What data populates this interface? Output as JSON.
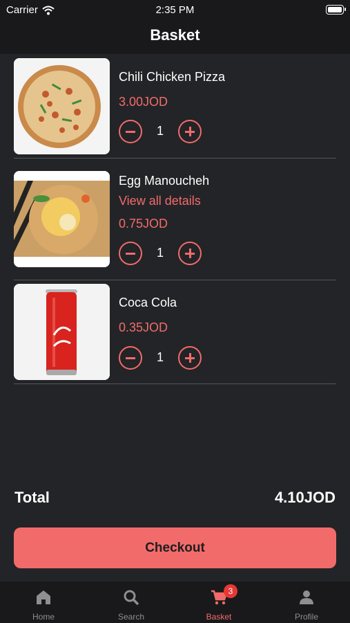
{
  "status": {
    "carrier": "Carrier",
    "time": "2:35 PM"
  },
  "header": {
    "title": "Basket"
  },
  "items": [
    {
      "name": "Chili Chicken Pizza",
      "price": "3.00JOD",
      "qty": "1"
    },
    {
      "name": "Egg Manoucheh",
      "details_link": "View all details",
      "price": "0.75JOD",
      "qty": "1"
    },
    {
      "name": "Coca Cola",
      "price": "0.35JOD",
      "qty": "1"
    }
  ],
  "total": {
    "label": "Total",
    "value": "4.10JOD"
  },
  "checkout_label": "Checkout",
  "tabbar": {
    "tabs": [
      {
        "label": "Home",
        "icon": "home-icon"
      },
      {
        "label": "Search",
        "icon": "search-icon"
      },
      {
        "label": "Basket",
        "icon": "cart-icon",
        "badge": "3",
        "active": true
      },
      {
        "label": "Profile",
        "icon": "profile-icon"
      }
    ]
  },
  "colors": {
    "accent": "#f26b6b",
    "background": "#232427",
    "bar": "#19191b",
    "badge": "#e53935"
  }
}
